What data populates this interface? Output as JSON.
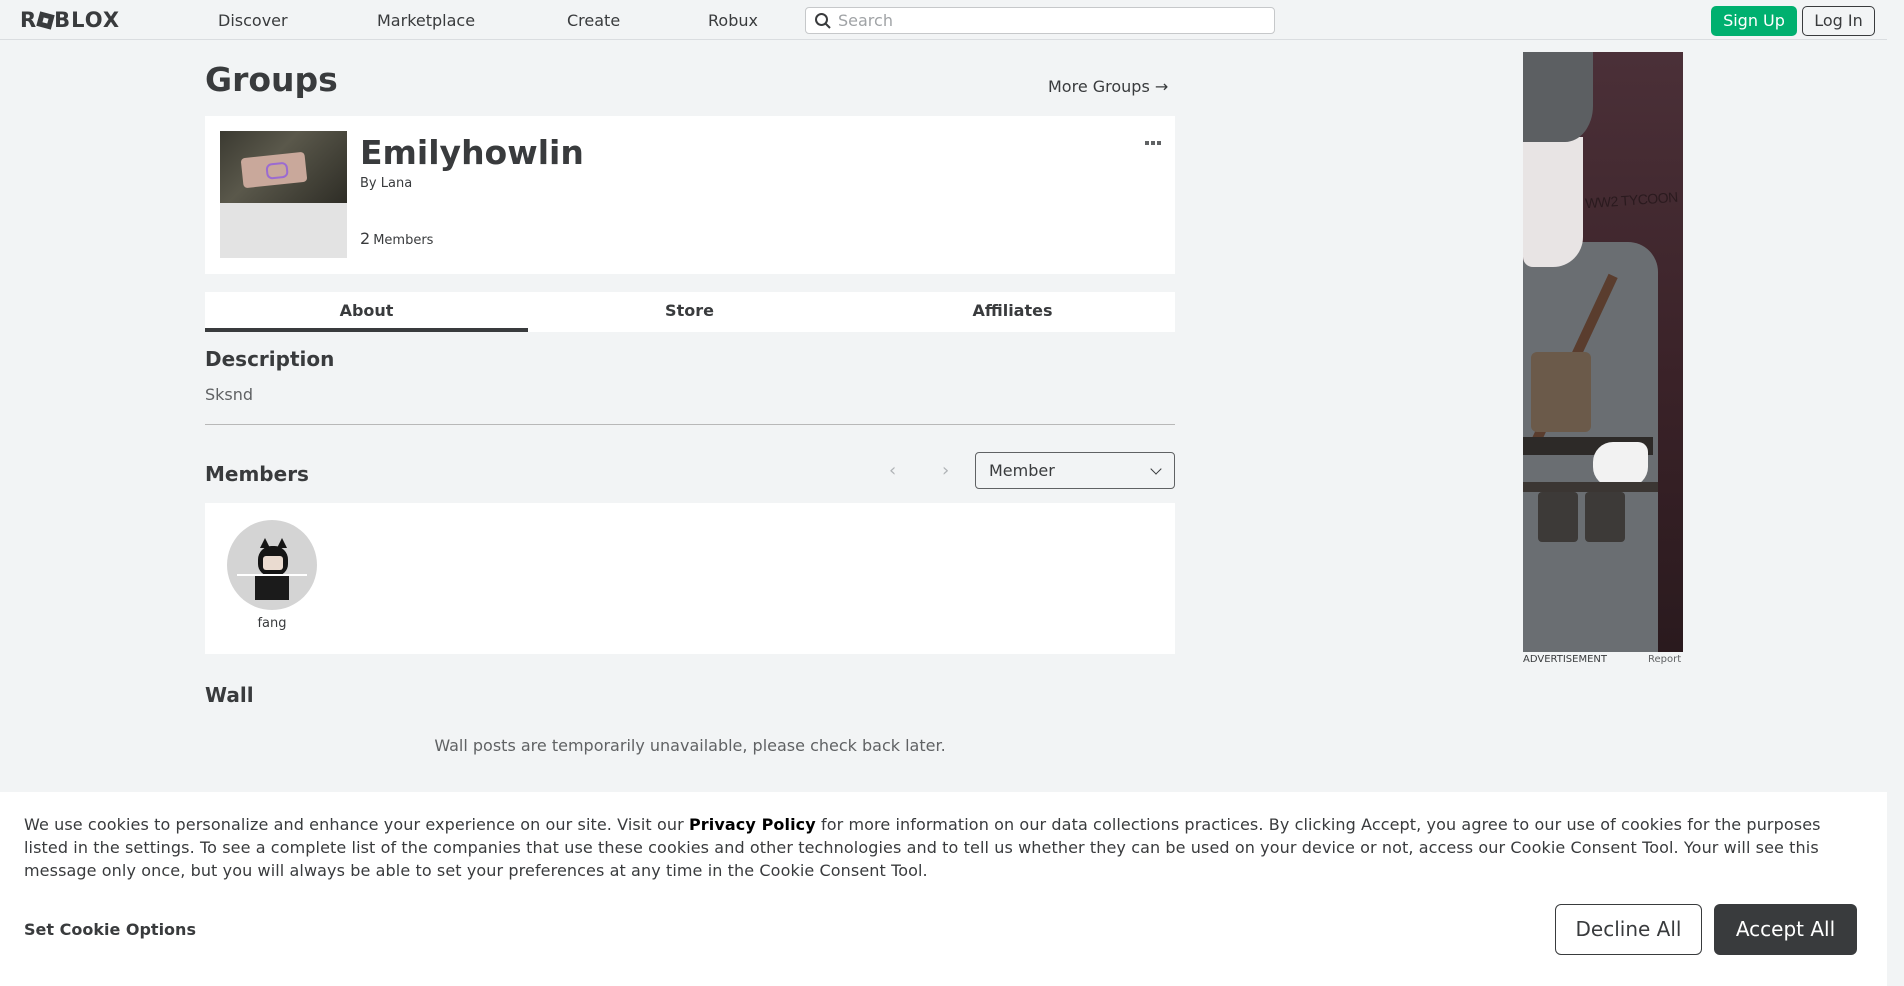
{
  "header": {
    "logo_text": "ROBLOX",
    "nav": [
      "Discover",
      "Marketplace",
      "Create",
      "Robux"
    ],
    "search_placeholder": "Search",
    "signup_label": "Sign Up",
    "login_label": "Log In"
  },
  "page": {
    "title": "Groups",
    "more_groups_label": "More Groups →"
  },
  "group": {
    "name": "Emilyhowlin",
    "by_prefix": "By",
    "owner": "Lana",
    "member_count": "2",
    "members_label": "Members"
  },
  "tabs": [
    "About",
    "Store",
    "Affiliates"
  ],
  "description": {
    "heading": "Description",
    "text": "Sksnd"
  },
  "members": {
    "heading": "Members",
    "role_selected": "Member",
    "list": [
      {
        "name": "fang"
      }
    ]
  },
  "wall": {
    "heading": "Wall",
    "message": "Wall posts are temporarily unavailable, please check back later."
  },
  "ad": {
    "label": "ADVERTISEMENT",
    "report_label": "Report",
    "image_text": "WW2 TYCOON"
  },
  "cookie": {
    "text_before": "We use cookies to personalize and enhance your experience on our site. Visit our",
    "policy_link": "Privacy Policy",
    "text_after": "for more information on our data collections practices. By clicking Accept, you agree to our use of cookies for the purposes listed in the settings. To see a complete list of the companies that use these cookies and other technologies and to tell us whether they can be used on your device or not, access our Cookie Consent Tool. Your will see this message only once, but you will always be able to set your preferences at any time in the Cookie Consent Tool.",
    "options_label": "Set Cookie Options",
    "decline_label": "Decline All",
    "accept_label": "Accept All"
  },
  "colors": {
    "background": "#f2f4f5",
    "signup_green": "#00b06f",
    "text_dark": "#393b3d"
  }
}
